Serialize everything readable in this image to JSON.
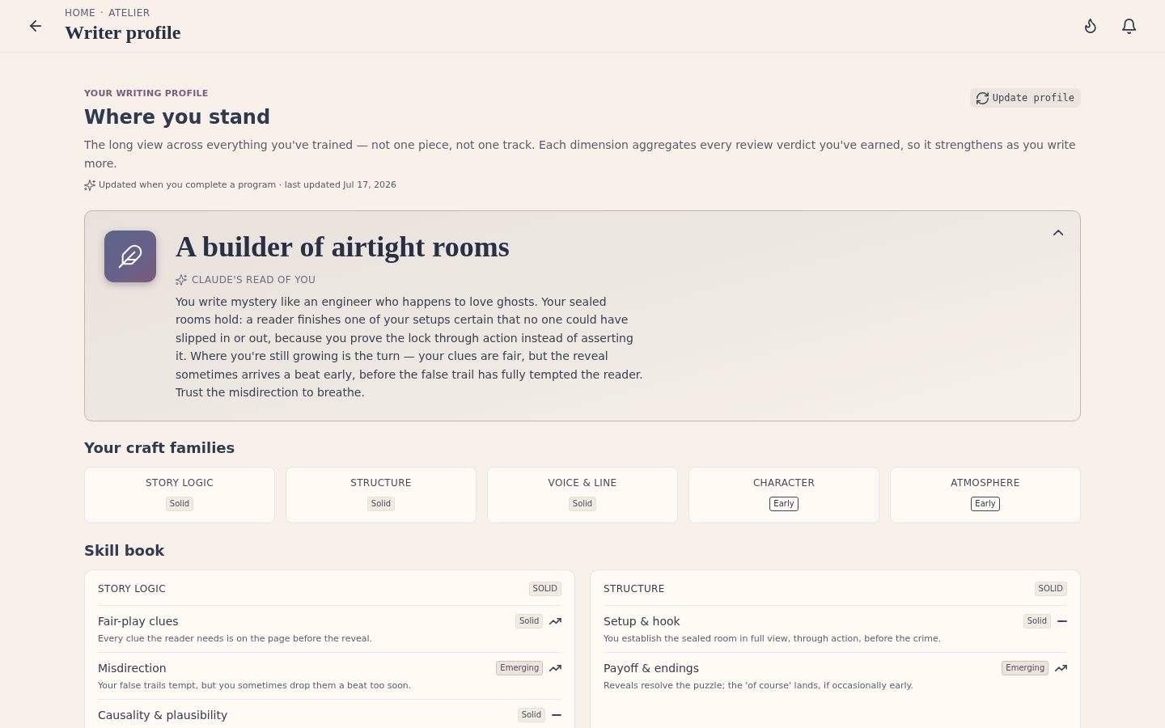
{
  "header": {
    "breadcrumb": [
      "HOME",
      "ATELIER"
    ],
    "breadcrumb_separator": "·",
    "title": "Writer profile"
  },
  "intro": {
    "eyebrow": "YOUR WRITING PROFILE",
    "heading": "Where you stand",
    "description": "The long view across everything you've trained — not one piece, not one track. Each dimension aggregates every review verdict you've earned, so it strengthens as you write more.",
    "update_note": "Updated when you complete a program · last updated Jul 17, 2026",
    "update_button": "Update profile"
  },
  "persona_card": {
    "title": "A builder of airtight rooms",
    "label": "CLAUDE'S READ OF YOU",
    "summary": "You write mystery like an engineer who happens to love ghosts. Your sealed rooms hold: a reader finishes one of your setups certain that no one could have slipped in or out, because you prove the lock through action instead of asserting it. Where you're still growing is the turn — your clues are fair, but the reveal sometimes arrives a beat early, before the false trail has fully tempted the reader. Trust the misdirection to breathe.",
    "expanded": true
  },
  "craft_families": {
    "heading": "Your craft families",
    "items": [
      {
        "name": "STORY LOGIC",
        "badge": "Solid",
        "kind": "solid"
      },
      {
        "name": "STRUCTURE",
        "badge": "Solid",
        "kind": "solid"
      },
      {
        "name": "VOICE & LINE",
        "badge": "Solid",
        "kind": "solid"
      },
      {
        "name": "CHARACTER",
        "badge": "Early",
        "kind": "early"
      },
      {
        "name": "ATMOSPHERE",
        "badge": "Early",
        "kind": "early"
      }
    ]
  },
  "skill_book": {
    "heading": "Skill book",
    "groups": [
      {
        "name": "STORY LOGIC",
        "badge": "SOLID",
        "kind": "solid",
        "skills": [
          {
            "name": "Fair-play clues",
            "description": "Every clue the reader needs is on the page before the reveal.",
            "badge": "Solid",
            "kind": "solid",
            "rising": true
          },
          {
            "name": "Misdirection",
            "description": "Your false trails tempt, but you sometimes drop them a beat too soon.",
            "badge": "Emerging",
            "kind": "emerging",
            "rising": true
          },
          {
            "name": "Causality & plausibility",
            "badge": "Solid",
            "kind": "solid",
            "rising": false
          }
        ]
      },
      {
        "name": "STRUCTURE",
        "badge": "SOLID",
        "kind": "solid",
        "skills": [
          {
            "name": "Setup & hook",
            "description": "You establish the sealed room in full view, through action, before the crime.",
            "badge": "Solid",
            "kind": "solid",
            "rising": false
          },
          {
            "name": "Payoff & endings",
            "description": "Reveals resolve the puzzle; the 'of course' lands, if occasionally early.",
            "badge": "Emerging",
            "kind": "emerging",
            "rising": true
          }
        ]
      }
    ]
  }
}
